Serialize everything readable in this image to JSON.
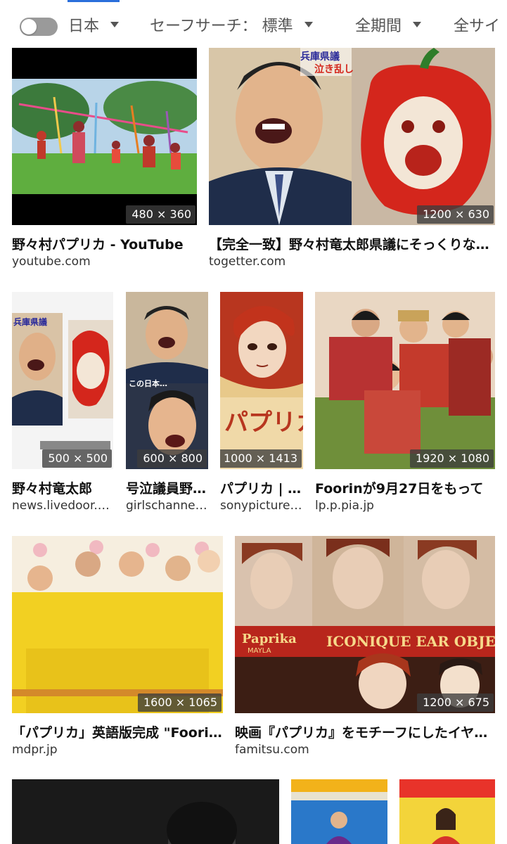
{
  "filters": {
    "region": "日本",
    "safesearch": "セーフサーチ： 標準",
    "period": "全期間",
    "site": "全サイ"
  },
  "results": [
    {
      "title": "野々村パプリカ - YouTube",
      "source": "youtube.com",
      "dims": "480 × 360"
    },
    {
      "title": "【完全一致】野々村竜太郎県議にそっくりなパプリカ",
      "source": "togetter.com",
      "dims": "1200 × 630"
    },
    {
      "title": "野々村竜太郎",
      "source": "news.livedoor.com",
      "dims": "500 × 500"
    },
    {
      "title": "号泣議員野々村",
      "source": "girlschannel.net",
      "dims": "600 × 800"
    },
    {
      "title": "パプリカ | ソニー",
      "source": "sonypictures.jp",
      "dims": "1000 × 1413"
    },
    {
      "title": "Foorinが9月27日をもって",
      "source": "lp.p.pia.jp",
      "dims": "1920 × 1080"
    },
    {
      "title": "「パプリカ」英語版完成 \"Foorin team E\"",
      "source": "mdpr.jp",
      "dims": "1600 × 1065"
    },
    {
      "title": "映画『パプリカ』をモチーフにしたイヤーカフ",
      "source": "famitsu.com",
      "dims": "1200 × 675"
    }
  ],
  "overlay_text": {
    "banner_top": "兵庫県議",
    "banner_sub": "泣き乱し",
    "meme_caption": "この日本…",
    "poster_title": "パプリカ",
    "ad_brand": "Paprika",
    "ad_brand_sub": "MAYLA",
    "ad_slogan": "ICONIQUE EAR OBJET"
  }
}
